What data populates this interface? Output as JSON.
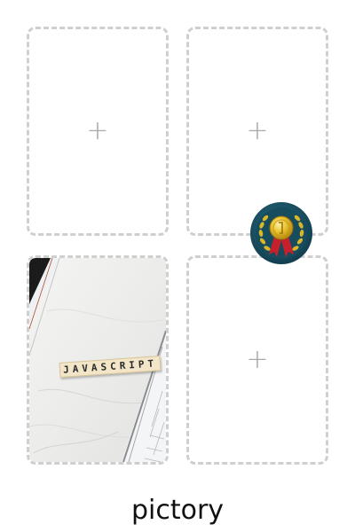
{
  "slots": {
    "add_symbol": "+",
    "photo_tile_text": "JAVASCRIPT"
  },
  "caption": "pictory",
  "icons": {
    "add": "plus-icon",
    "badge": "award-medal-icon"
  },
  "colors": {
    "slot_border": "#cfcfcf",
    "plus": "#a9a9a9",
    "badge_ring": "#1f5a6e",
    "badge_laurel": "#d9b72a",
    "badge_medal": "#e8c12f",
    "badge_ribbon": "#c8202b"
  }
}
